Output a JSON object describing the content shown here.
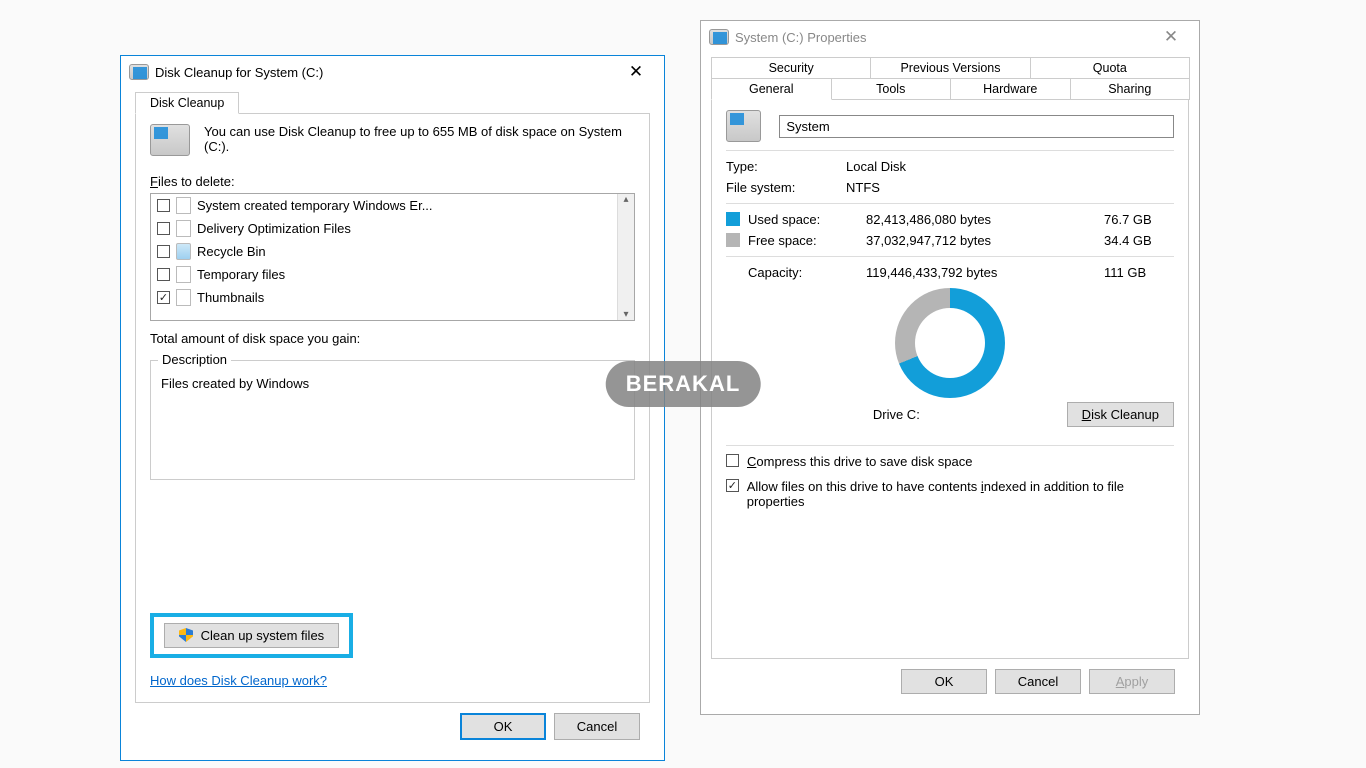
{
  "watermark": "BERAKAL",
  "diskcleanup": {
    "title": "Disk Cleanup for System (C:)",
    "tab": "Disk Cleanup",
    "intro": "You can use Disk Cleanup to free up to 655 MB of disk space on System (C:).",
    "files_label": "Files to delete:",
    "items": [
      {
        "label": "System created temporary Windows Er...",
        "checked": false,
        "icon": "file"
      },
      {
        "label": "Delivery Optimization Files",
        "checked": false,
        "icon": "file"
      },
      {
        "label": "Recycle Bin",
        "checked": false,
        "icon": "recycle"
      },
      {
        "label": "Temporary files",
        "checked": false,
        "icon": "file"
      },
      {
        "label": "Thumbnails",
        "checked": true,
        "icon": "file"
      }
    ],
    "total_label": "Total amount of disk space you gain:",
    "desc_legend": "Description",
    "desc_text": "Files created by Windows",
    "clean_sys": "Clean up system files",
    "help_link": "How does Disk Cleanup work?",
    "ok": "OK",
    "cancel": "Cancel"
  },
  "properties": {
    "title": "System (C:) Properties",
    "tabs_back": [
      "Security",
      "Previous Versions",
      "Quota"
    ],
    "tabs_front": [
      "General",
      "Tools",
      "Hardware",
      "Sharing"
    ],
    "active_tab": "General",
    "volume_name": "System",
    "type_label": "Type:",
    "type_value": "Local Disk",
    "fs_label": "File system:",
    "fs_value": "NTFS",
    "used_label": "Used space:",
    "used_bytes": "82,413,486,080 bytes",
    "used_h": "76.7 GB",
    "free_label": "Free space:",
    "free_bytes": "37,032,947,712 bytes",
    "free_h": "34.4 GB",
    "cap_label": "Capacity:",
    "cap_bytes": "119,446,433,792 bytes",
    "cap_h": "111 GB",
    "drive_label": "Drive C:",
    "disk_cleanup_btn": "Disk Cleanup",
    "compress_cb": "Compress this drive to save disk space",
    "compress_checked": false,
    "index_cb": "Allow files on this drive to have contents indexed in addition to file properties",
    "index_checked": true,
    "ok": "OK",
    "cancel": "Cancel",
    "apply": "Apply"
  },
  "chart_data": {
    "type": "pie",
    "title": "Drive C:",
    "series": [
      {
        "name": "Used space",
        "value_bytes": 82413486080,
        "value_h": "76.7 GB",
        "color": "#129ed9"
      },
      {
        "name": "Free space",
        "value_bytes": 37032947712,
        "value_h": "34.4 GB",
        "color": "#b5b5b5"
      }
    ],
    "total_bytes": 119446433792,
    "total_h": "111 GB"
  }
}
